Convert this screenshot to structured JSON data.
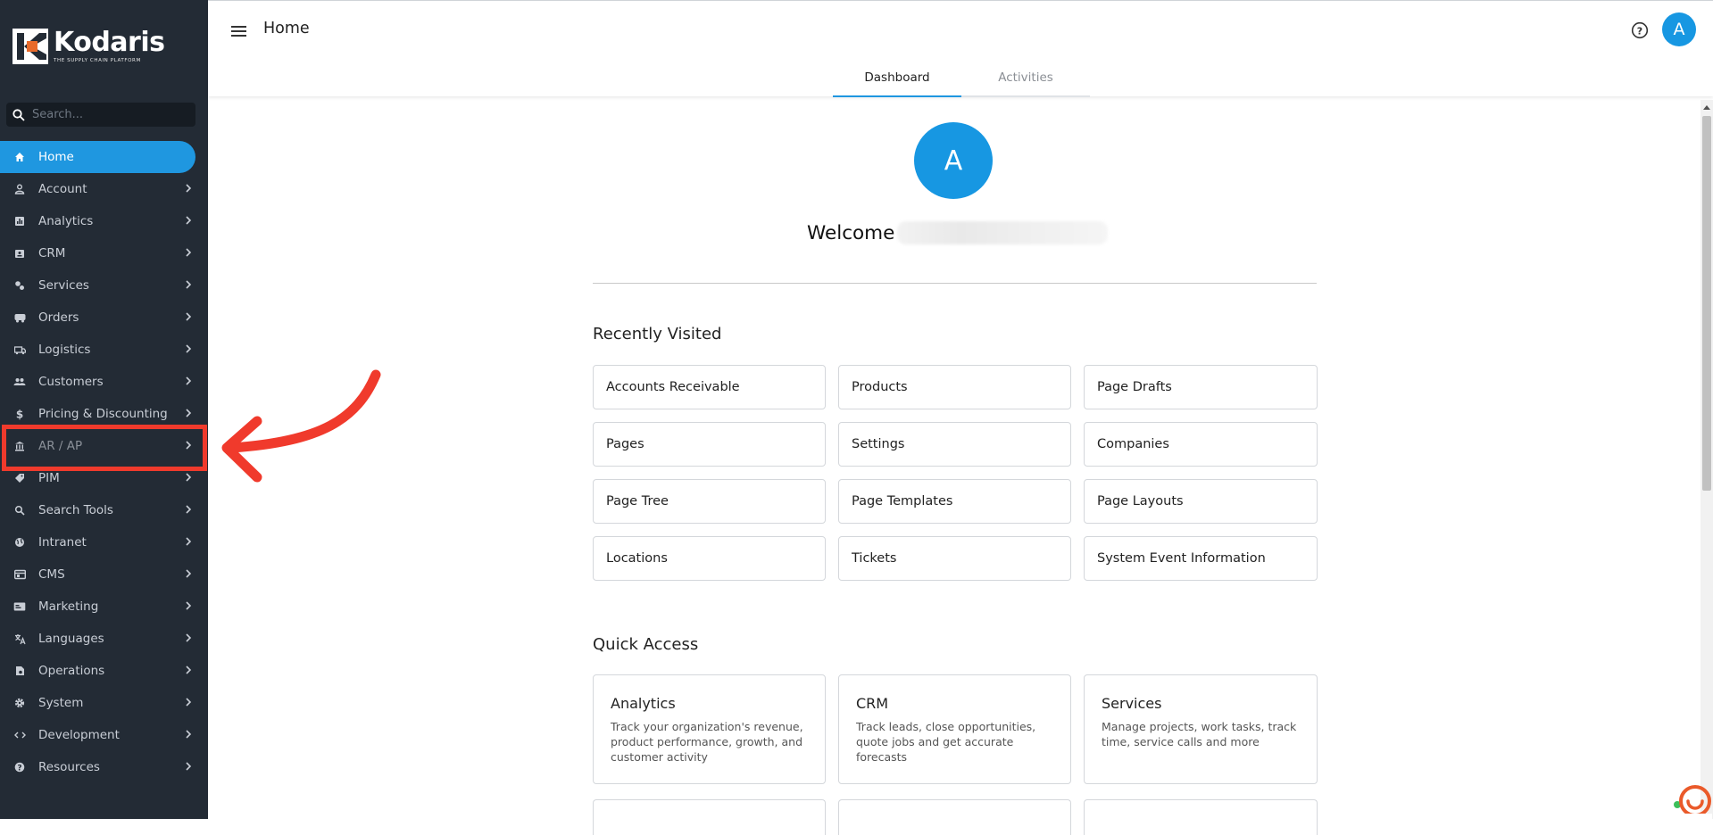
{
  "brand": {
    "name": "Kodaris",
    "tagline": "THE SUPPLY CHAIN PLATFORM",
    "logo_icon": "kodaris-k-logo"
  },
  "sidebar": {
    "search_placeholder": "Search...",
    "items": [
      {
        "label": "Home",
        "icon": "home-icon",
        "active": true
      },
      {
        "label": "Account",
        "icon": "person-icon"
      },
      {
        "label": "Analytics",
        "icon": "chart-icon"
      },
      {
        "label": "CRM",
        "icon": "contact-card-icon"
      },
      {
        "label": "Services",
        "icon": "services-icon"
      },
      {
        "label": "Orders",
        "icon": "truck-icon"
      },
      {
        "label": "Logistics",
        "icon": "delivery-icon"
      },
      {
        "label": "Customers",
        "icon": "people-icon"
      },
      {
        "label": "Pricing & Discounting",
        "icon": "dollar-icon"
      },
      {
        "label": "AR / AP",
        "icon": "bank-icon",
        "highlighted": true
      },
      {
        "label": "PIM",
        "icon": "tag-icon"
      },
      {
        "label": "Search Tools",
        "icon": "search-icon"
      },
      {
        "label": "Intranet",
        "icon": "globe-icon"
      },
      {
        "label": "CMS",
        "icon": "window-icon"
      },
      {
        "label": "Marketing",
        "icon": "megaphone-icon"
      },
      {
        "label": "Languages",
        "icon": "translate-icon"
      },
      {
        "label": "Operations",
        "icon": "operations-icon"
      },
      {
        "label": "System",
        "icon": "gear-icon"
      },
      {
        "label": "Development",
        "icon": "code-icon"
      },
      {
        "label": "Resources",
        "icon": "help-circle-icon"
      }
    ]
  },
  "header": {
    "title": "Home",
    "avatar_initial": "A",
    "help_icon": "help-circle-icon"
  },
  "tabs": [
    {
      "label": "Dashboard",
      "active": true
    },
    {
      "label": "Activities"
    }
  ],
  "welcome": {
    "avatar_initial": "A",
    "text": "Welcome"
  },
  "recently_visited": {
    "title": "Recently Visited",
    "items": [
      "Accounts Receivable",
      "Products",
      "Page Drafts",
      "Pages",
      "Settings",
      "Companies",
      "Page Tree",
      "Page Templates",
      "Page Layouts",
      "Locations",
      "Tickets",
      "System Event Information"
    ]
  },
  "quick_access": {
    "title": "Quick Access",
    "items": [
      {
        "title": "Analytics",
        "desc": "Track your organization's revenue, product performance, growth, and customer activity"
      },
      {
        "title": "CRM",
        "desc": "Track leads, close opportunities, quote jobs and get accurate forecasts"
      },
      {
        "title": "Services",
        "desc": "Manage projects, work tasks, track time, service calls and more"
      }
    ]
  },
  "colors": {
    "sidebar_bg": "#232b35",
    "accent": "#1f97e0",
    "highlight": "#f03a2c"
  }
}
